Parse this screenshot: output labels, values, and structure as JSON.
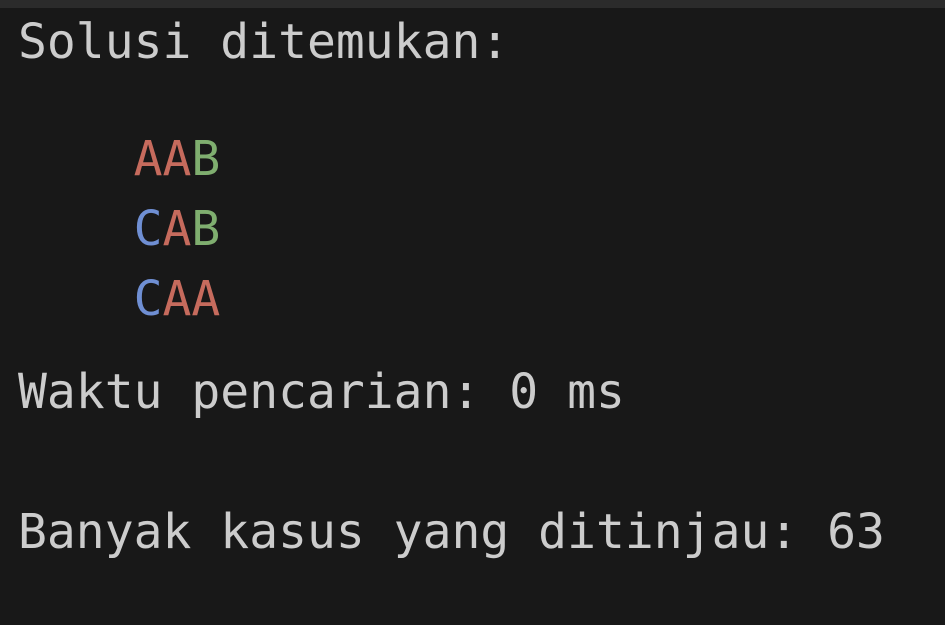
{
  "terminal": {
    "header": "Solusi ditemukan:",
    "solutions": [
      {
        "chars": [
          {
            "text": "A",
            "color": "#c66b5d"
          },
          {
            "text": "A",
            "color": "#c66b5d"
          },
          {
            "text": "B",
            "color": "#7fae6f"
          }
        ]
      },
      {
        "chars": [
          {
            "text": "C",
            "color": "#6f8fd3"
          },
          {
            "text": "A",
            "color": "#c66b5d"
          },
          {
            "text": "B",
            "color": "#7fae6f"
          }
        ]
      },
      {
        "chars": [
          {
            "text": "C",
            "color": "#6f8fd3"
          },
          {
            "text": "A",
            "color": "#c66b5d"
          },
          {
            "text": "A",
            "color": "#c66b5d"
          }
        ]
      }
    ],
    "search_time": "Waktu pencarian: 0 ms",
    "cases_reviewed": "Banyak kasus yang ditinjau: 63"
  },
  "colors": {
    "background": "#181818",
    "text": "#cccccc",
    "A": "#c66b5d",
    "B": "#7fae6f",
    "C": "#6f8fd3"
  }
}
